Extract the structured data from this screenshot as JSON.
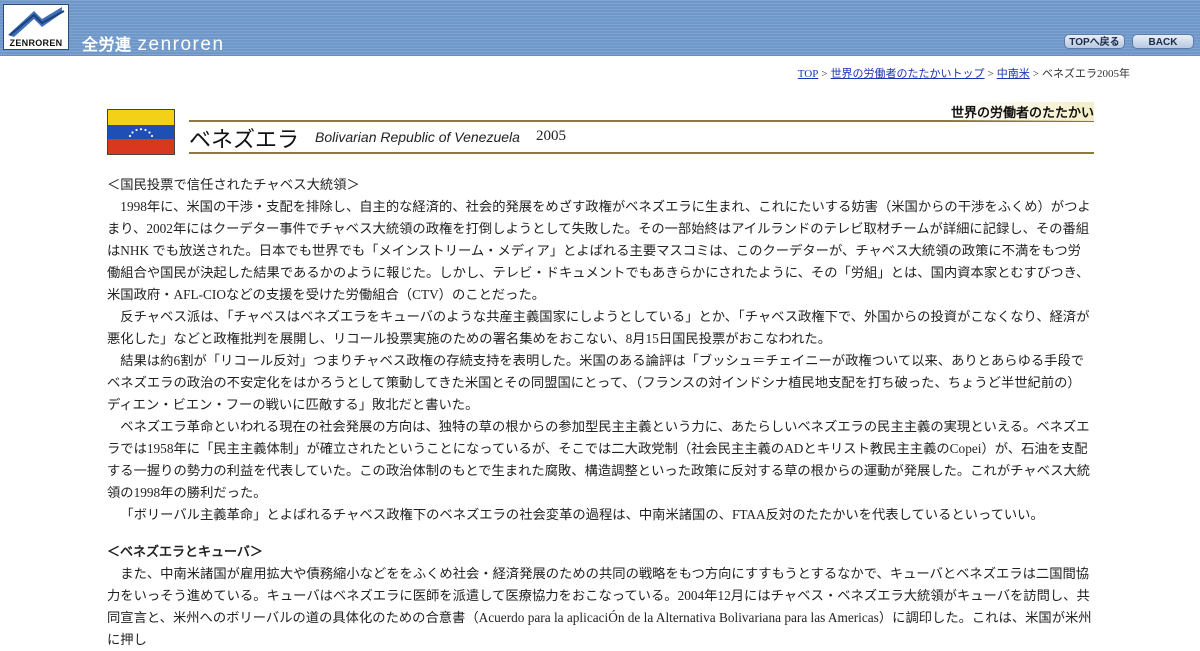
{
  "header": {
    "logo_text": "ZENROREN",
    "site_name_jp": "全労連",
    "site_name_en": "zenroren",
    "top_button": "TOPへ戻る",
    "back_button": "BACK"
  },
  "breadcrumb": {
    "items": [
      "TOP",
      "世界の労働者のたたかいトップ",
      "中南米"
    ],
    "current": "ベネズエラ2005年",
    "separator": ">"
  },
  "section": {
    "label": "世界の労働者のたたかい"
  },
  "country": {
    "name": "ベネズエラ",
    "english": "Bolivarian Republic of Venezuela",
    "year": "2005",
    "flag_colors": [
      "#f2d118",
      "#1d4fb5",
      "#d9381e"
    ]
  },
  "article": {
    "heading1": "＜国民投票で信任されたチャベス大統領＞",
    "p1": "1998年に、米国の干渉・支配を排除し、自主的な経済的、社会的発展をめざす政権がベネズエラに生まれ、これにたいする妨害（米国からの干渉をふくめ）がつよまり、2002年にはクーデター事件でチャベス大統領の政権を打倒しようとして失敗した。その一部始終はアイルランドのテレビ取材チームが詳細に記録し、その番組はNHK でも放送された。日本でも世界でも「メインストリーム・メディア」とよばれる主要マスコミは、このクーデターが、チャベス大統領の政策に不満をもつ労働組合や国民が決起した結果であるかのように報じた。しかし、テレビ・ドキュメントでもあきらかにされたように、その「労組」とは、国内資本家とむすびつき、米国政府・AFL-CIOなどの支援を受けた労働組合（CTV）のことだった。",
    "p2": "反チャベス派は、「チャベスはベネズエラをキューバのような共産主義国家にしようとしている」とか、「チャベス政権下で、外国からの投資がこなくなり、経済が悪化した」などと政権批判を展開し、リコール投票実施のための署名集めをおこない、8月15日国民投票がおこなわれた。",
    "p3": "結果は約6割が「リコール反対」つまりチャベス政権の存続支持を表明した。米国のある論評は「ブッシュ＝チェイニーが政権ついて以来、ありとあらゆる手段でベネズエラの政治の不安定化をはかろうとして策動してきた米国とその同盟国にとって、（フランスの対インドシナ植民地支配を打ち破った、ちょうど半世紀前の）ディエン・ビエン・フーの戦いに匹敵する」敗北だと書いた。",
    "p4": "ベネズエラ革命といわれる現在の社会発展の方向は、独特の草の根からの参加型民主主義という力に、あたらしいベネズエラの民主主義の実現といえる。ベネズエラでは1958年に「民主主義体制」が確立されたということになっているが、そこでは二大政党制（社会民主主義のADとキリスト教民主主義のCopei）が、石油を支配する一握りの勢力の利益を代表していた。この政治体制のもとで生まれた腐敗、構造調整といった政策に反対する草の根からの運動が発展した。これがチャベス大統領の1998年の勝利だった。",
    "p5": "「ボリーバル主義革命」とよばれるチャベス政権下のベネズエラの社会変革の過程は、中南米諸国の、FTAA反対のたたかいを代表しているといっていい。",
    "heading2": "＜ベネズエラとキューバ＞",
    "p6": "また、中南米諸国が雇用拡大や債務縮小などををふくめ社会・経済発展のための共同の戦略をもつ方向にすすもうとするなかで、キューバとベネズエラは二国間協力をいっそう進めている。キューバはベネズエラに医師を派遣して医療協力をおこなっている。2004年12月にはチャベス・ベネズエラ大統領がキューバを訪問し、共同宣言と、米州へのボリーバルの道の具体化のための合意書（Acuerdo para la aplicaciÓn de la Alternativa Bolivariana para las Americas）に調印した。これは、米国が米州に押し"
  }
}
